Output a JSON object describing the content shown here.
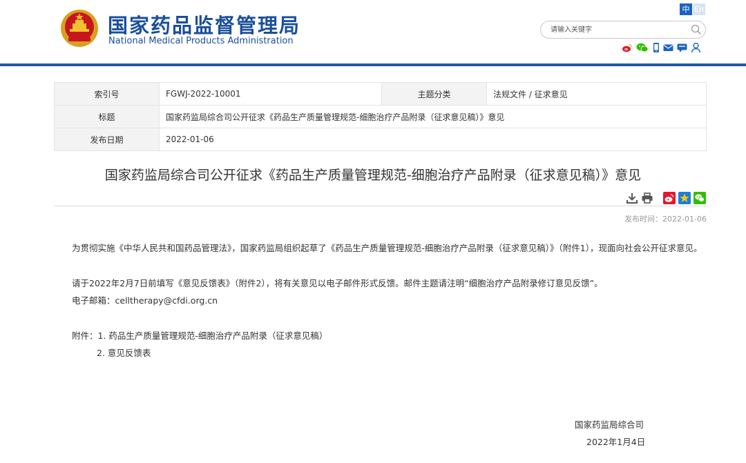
{
  "header": {
    "site_name_cn": "国家药品监督管理局",
    "site_name_en": "National Medical Products Administration",
    "lang_zh": "中",
    "lang_en": "En",
    "search_placeholder": "请输入关键字",
    "icons": [
      "weibo-icon",
      "wechat-icon",
      "mobile-icon",
      "mail-icon",
      "chat-icon",
      "user-icon"
    ]
  },
  "info_table": {
    "index_label": "索引号",
    "index_value": "FGWJ-2022-10001",
    "category_label": "主题分类",
    "category_value": "法规文件 / 征求意见",
    "title_label": "标题",
    "title_value": "国家药监局综合司公开征求《药品生产质量管理规范-细胞治疗产品附录（征求意见稿）》意见",
    "date_label": "发布日期",
    "date_value": "2022-01-06"
  },
  "article": {
    "title": "国家药监局综合司公开征求《药品生产质量管理规范-细胞治疗产品附录（征求意见稿）》意见",
    "publish_time": "发布时间：2022-01-06",
    "para1": "为贯彻实施《中华人民共和国药品管理法》，国家药监局组织起草了《药品生产质量管理规范-细胞治疗产品附录（征求意见稿）》（附件1），现面向社会公开征求意见。",
    "para2": "请于2022年2月7日前填写《意见反馈表》（附件2），将有关意见以电子邮件形式反馈。邮件主题请注明“细胞治疗产品附录修订意见反馈”。",
    "email": "电子邮箱：celltherapy@cfdi.org.cn",
    "attachment1": "附件：1. 药品生产质量管理规范-细胞治疗产品附录（征求意见稿）",
    "attachment2": "2. 意见反馈表",
    "signature_org": "国家药监局综合司",
    "signature_date": "2022年1月4日"
  },
  "colors": {
    "brand_blue": "#1a4f9c",
    "rule_blue": "#1f5aa6",
    "weibo": "#e6162d",
    "wechat": "#2dc100",
    "star": "#f5a623"
  }
}
